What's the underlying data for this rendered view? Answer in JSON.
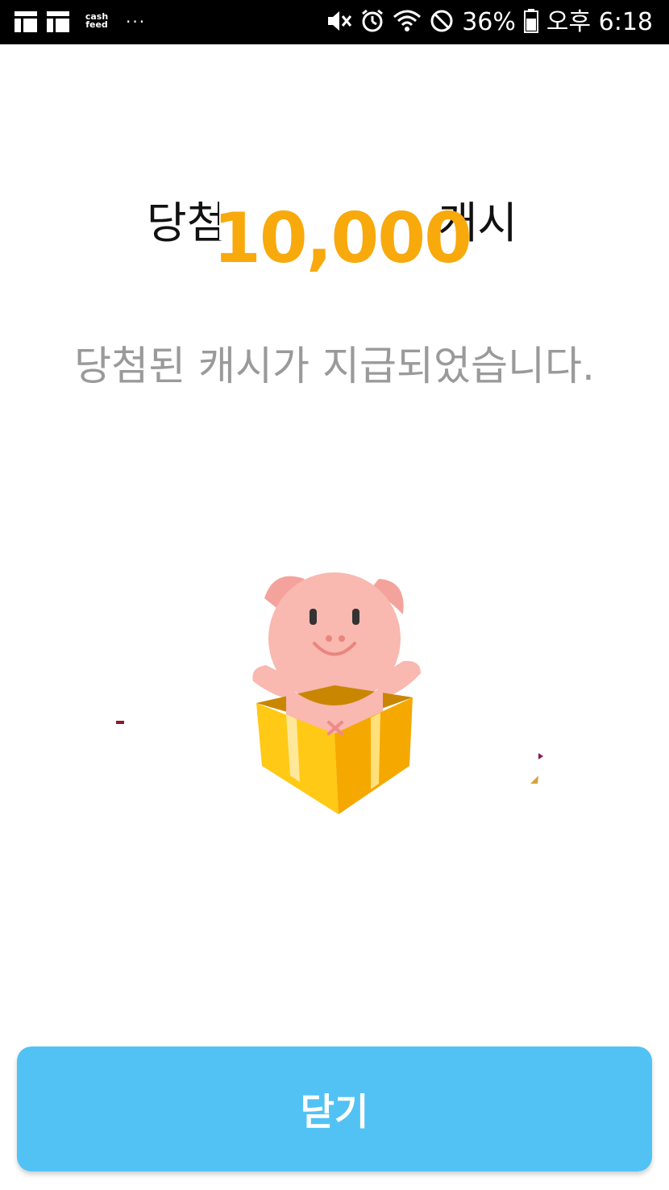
{
  "status_bar": {
    "left_icons": [
      "grid-icon",
      "grid-icon",
      "cashfeed-icon",
      "more-dots-icon"
    ],
    "cashfeed_label_top": "cash",
    "cashfeed_label_bottom": "feed",
    "dots": "···",
    "right_icons": [
      "mute-icon",
      "alarm-icon",
      "wifi-icon",
      "block-icon",
      "battery-icon"
    ],
    "battery_percent": "36%",
    "clock": "오후 6:18"
  },
  "result": {
    "title_prefix": "당첨",
    "title_suffix": "캐시",
    "amount": "10,000",
    "subtitle": "당첨된 캐시가 지급되었습니다."
  },
  "illustration": {
    "name": "pig-in-gift-box",
    "colors": {
      "pig": "#f9b8b0",
      "box": "#ffc20e",
      "box_dark": "#f5a800"
    }
  },
  "actions": {
    "close_label": "닫기"
  },
  "colors": {
    "accent": "#f8a90c",
    "button": "#52c2f5",
    "subtitle_text": "#9a9a9a"
  }
}
